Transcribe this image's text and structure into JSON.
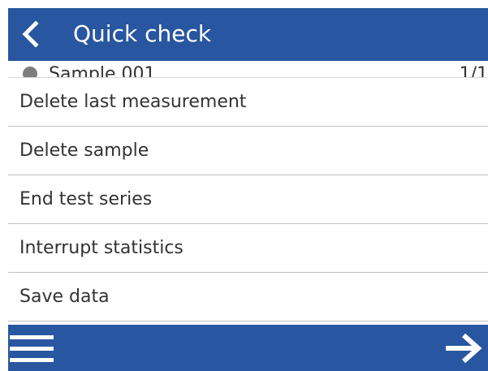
{
  "header": {
    "title": "Quick check",
    "back_icon": "chevron-left-icon",
    "color": "#2856a0"
  },
  "background_row": {
    "label": "Sample 001",
    "count": "1/1",
    "status_icon": "status-dot-icon"
  },
  "menu": {
    "items": [
      {
        "label": "Delete last measurement"
      },
      {
        "label": "Delete sample"
      },
      {
        "label": "End test series"
      },
      {
        "label": "Interrupt statistics"
      },
      {
        "label": "Save data"
      }
    ]
  },
  "footer": {
    "menu_icon": "hamburger-menu-icon",
    "next_icon": "arrow-right-icon",
    "color": "#2856a0"
  }
}
